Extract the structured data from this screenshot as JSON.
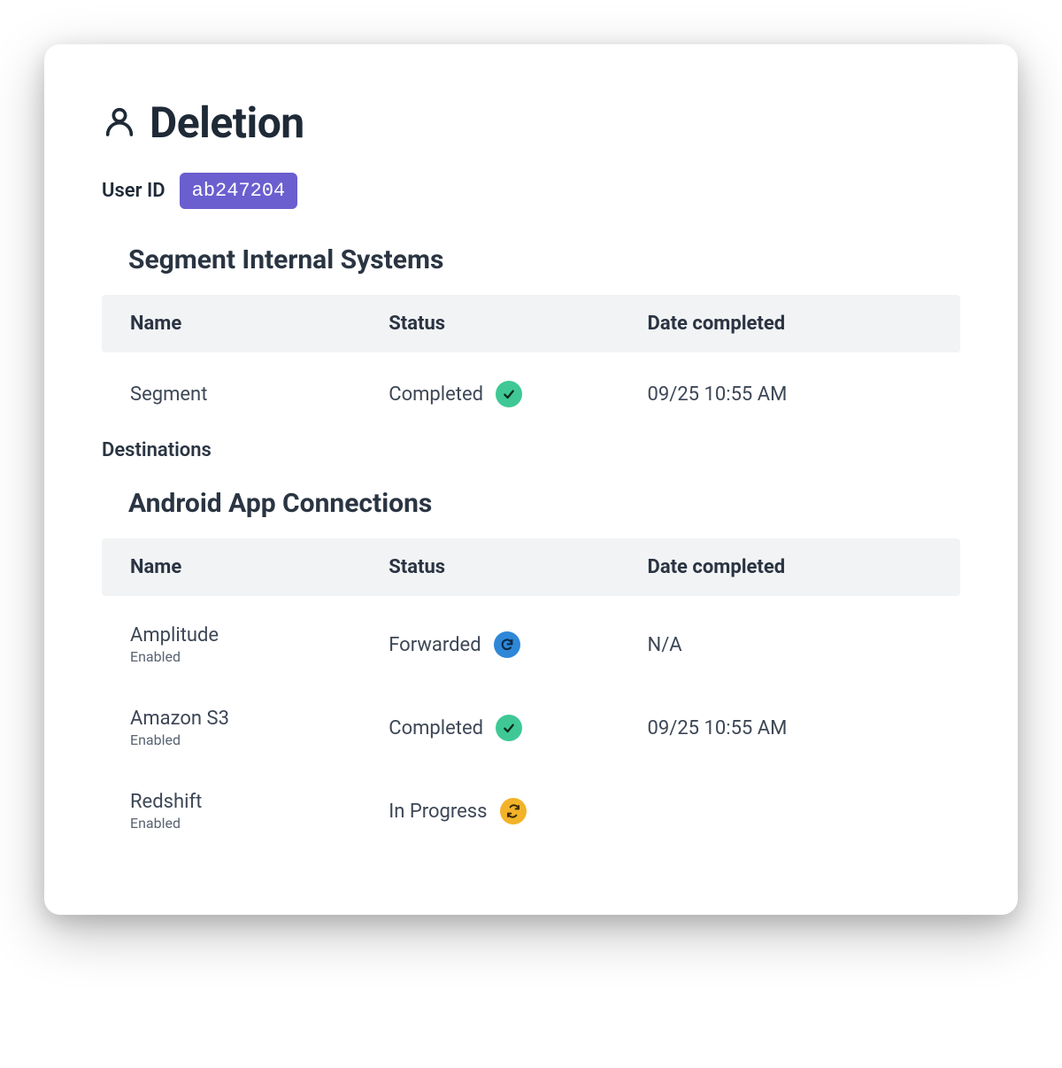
{
  "page": {
    "title": "Deletion"
  },
  "user": {
    "id_label": "User ID",
    "id_value": "ab247204"
  },
  "table_columns": {
    "name": "Name",
    "status": "Status",
    "date": "Date completed"
  },
  "internal": {
    "heading": "Segment Internal Systems",
    "rows": [
      {
        "name": "Segment",
        "status": "Completed",
        "status_kind": "completed",
        "date": "09/25 10:55 AM"
      }
    ]
  },
  "destinations": {
    "label": "Destinations",
    "groups": [
      {
        "heading": "Android App Connections",
        "rows": [
          {
            "name": "Amplitude",
            "sub": "Enabled",
            "status": "Forwarded",
            "status_kind": "forwarded",
            "date": "N/A"
          },
          {
            "name": "Amazon S3",
            "sub": "Enabled",
            "status": "Completed",
            "status_kind": "completed",
            "date": "09/25 10:55 AM"
          },
          {
            "name": "Redshift",
            "sub": "Enabled",
            "status": "In Progress",
            "status_kind": "inprogress",
            "date": ""
          }
        ]
      }
    ]
  },
  "colors": {
    "chip": "#6b5ecf",
    "completed": "#3fc896",
    "forwarded": "#2f87d8",
    "inprogress": "#f2b32a"
  }
}
